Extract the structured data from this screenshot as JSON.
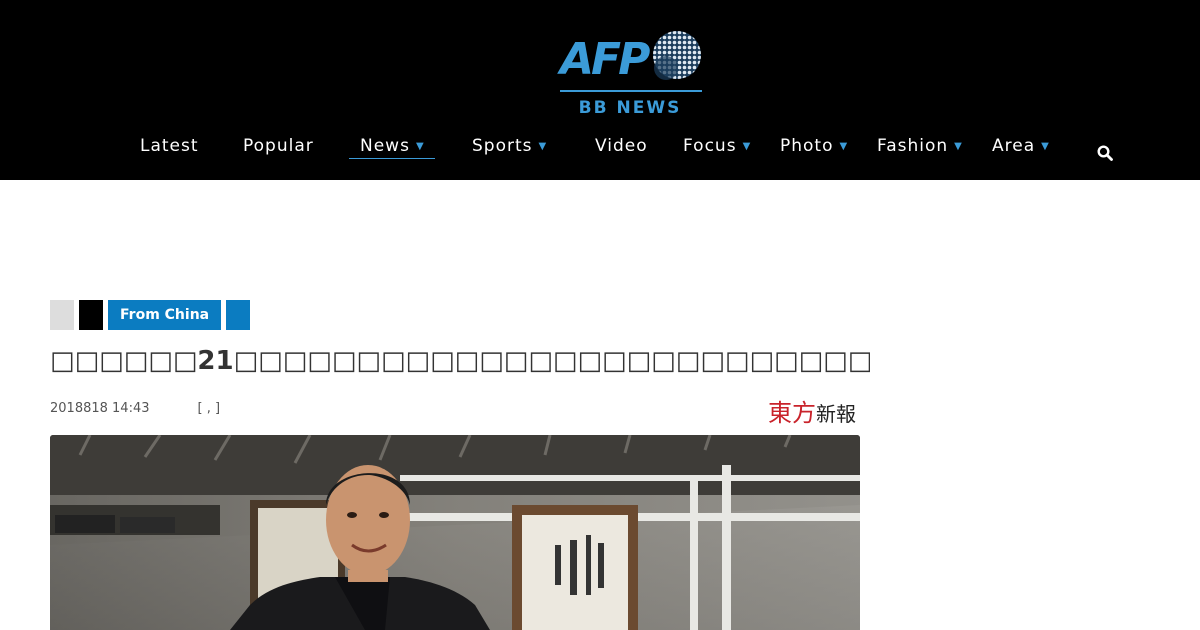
{
  "logo": {
    "brand": "AFP",
    "sub": "BB NEWS"
  },
  "nav": {
    "items": [
      {
        "label": "Latest",
        "dropdown": false
      },
      {
        "label": "Popular",
        "dropdown": false
      },
      {
        "label": "News",
        "dropdown": true,
        "active": true
      },
      {
        "label": "Sports",
        "dropdown": true
      },
      {
        "label": "Video",
        "dropdown": false
      },
      {
        "label": "Focus",
        "dropdown": true
      },
      {
        "label": "Photo",
        "dropdown": true
      },
      {
        "label": "Fashion",
        "dropdown": true
      },
      {
        "label": "Area",
        "dropdown": true
      }
    ],
    "chevron": "▼",
    "search_icon": "search-icon"
  },
  "tags": {
    "from_china": "From China"
  },
  "article": {
    "title": "□□□□□□21□□□□□□□□□□□□□□□□□□□□□□□□□□□□□",
    "date": "2018818 14:43",
    "source": "[ ,   ]",
    "publisher_logo_text_red": "東方",
    "publisher_logo_text_black": "新報"
  },
  "colors": {
    "accent": "#3b9bd8",
    "tag_blue": "#0b7cc1",
    "header_bg": "#000000",
    "publisher_red": "#c9232b"
  }
}
